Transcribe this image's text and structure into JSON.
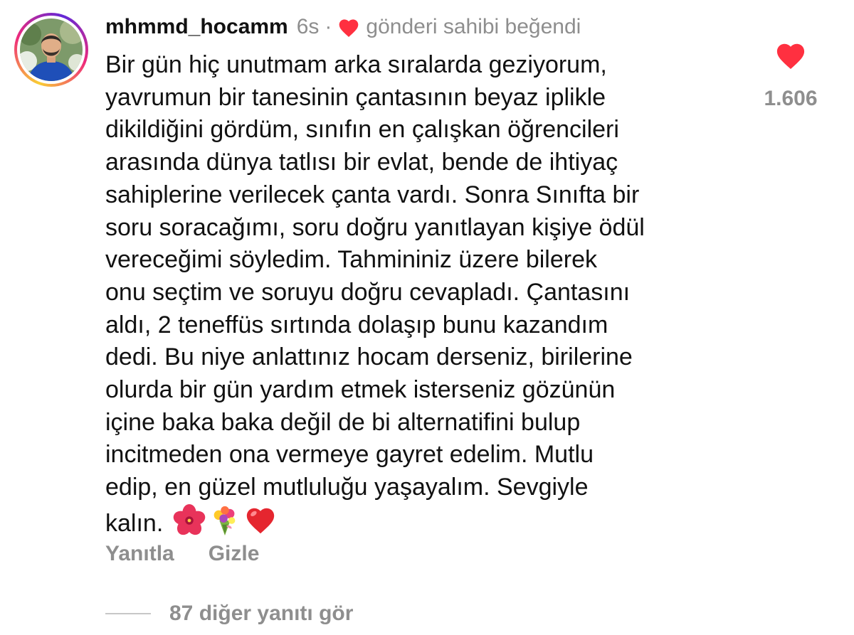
{
  "comment": {
    "username": "mhmmd_hocamm",
    "time": "6s",
    "separator": "·",
    "liked_by_author_text": "gönderi sahibi beğendi",
    "body": "Bir gün hiç unutmam arka sıralarda geziyorum,\nyavrumun bir tanesinin çantasının beyaz iplikle\ndikildiğini gördüm, sınıfın en çalışkan öğrencileri\narasında dünya tatlısı bir evlat, bende de ihtiyaç\nsahiplerine verilecek çanta vardı. Sonra Sınıfta bir\nsoru soracağımı, soru doğru yanıtlayan kişiye ödül\nvereceğimi söyledim. Tahmininiz üzere bilerek\nonu seçtim ve soruyu doğru cevapladı. Çantasını\naldı, 2 teneffüs sırtında dolaşıp bunu kazandım\ndedi. Bu niye anlattınız hocam derseniz, birilerine\nolurda bir gün yardım etmek isterseniz gözünün\niçine baka baka değil de bi alternatifini bulup\nincitmeden ona vermeye gayret edelim. Mutlu\nedip, en güzel mutluluğu yaşayalım. Sevgiyle\nkalın.",
    "emojis": [
      "hibiscus-emoji",
      "bouquet-emoji",
      "red-heart-emoji"
    ],
    "like_count": "1.606",
    "liked": true
  },
  "actions": {
    "reply_label": "Yanıtla",
    "hide_label": "Gizle"
  },
  "replies": {
    "more_label": "87 diğer yanıtı gör"
  },
  "colors": {
    "heart_red": "#ff3040",
    "muted_gray": "#8e8e8e",
    "text": "#111111"
  },
  "icons": {
    "liked_indicator": "heart-icon",
    "like_button": "heart-icon"
  }
}
